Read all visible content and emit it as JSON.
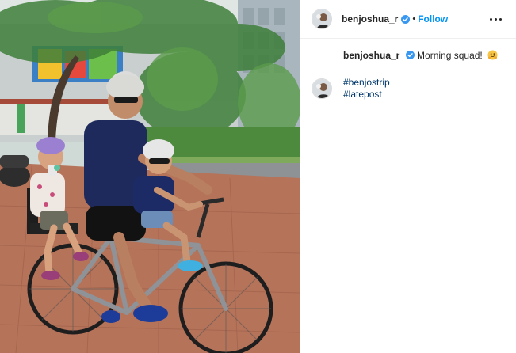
{
  "header": {
    "username": "benjoshua_r",
    "separator": "•",
    "follow_label": "Follow",
    "more_icon": "more-horizontal-icon"
  },
  "caption": {
    "username": "benjoshua_r",
    "text": "Morning squad!",
    "emoji": "hugging-face-emoji"
  },
  "comment": {
    "hashtags": [
      "#benjostrip",
      "#latepost"
    ]
  },
  "colors": {
    "link_blue": "#0095f6",
    "hashtag_blue": "#00376b",
    "verified_blue": "#3897f0",
    "text": "#262626",
    "divider": "#efefef"
  }
}
